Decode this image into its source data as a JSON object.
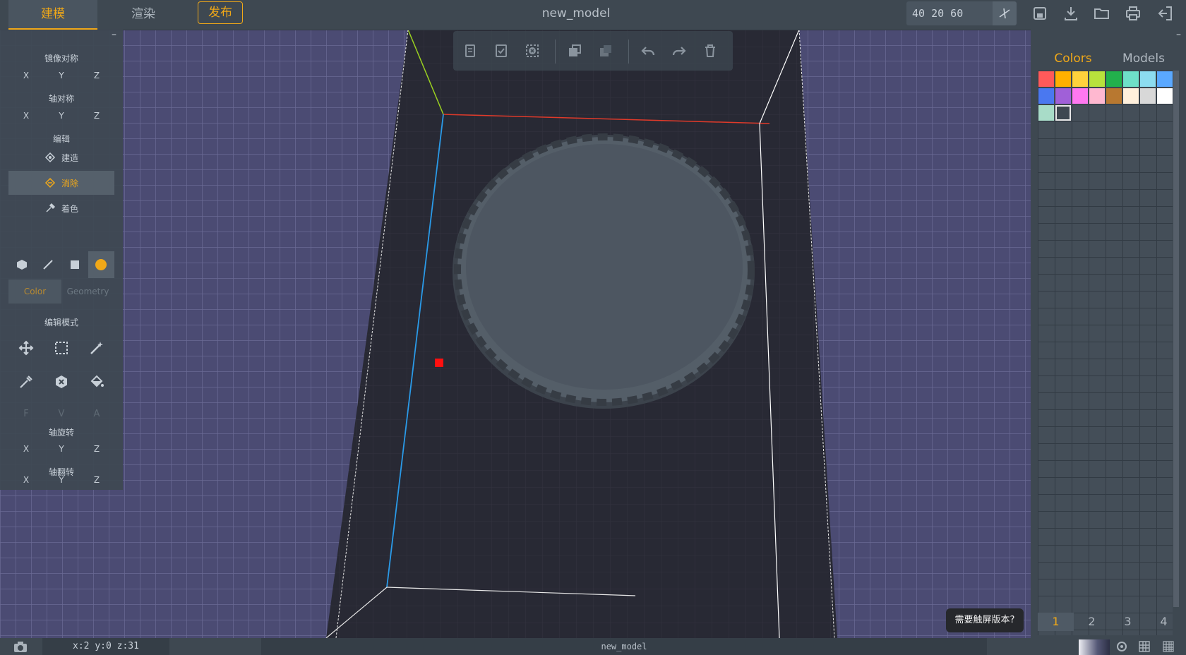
{
  "topbar": {
    "tab_model": "建模",
    "tab_render": "渲染",
    "publish": "发布",
    "title": "new_model",
    "dims": "40 20 60"
  },
  "left": {
    "mirror_title": "镜像对称",
    "axis_sym_title": "轴对称",
    "edit_title": "编辑",
    "build": "建造",
    "erase": "消除",
    "paint": "着色",
    "color_tab": "Color",
    "geometry_tab": "Geometry",
    "edit_mode_title": "编辑模式",
    "rotate_title": "轴旋转",
    "flip_title": "轴翻转",
    "x": "X",
    "y": "Y",
    "z": "Z",
    "f": "F",
    "v": "V",
    "a": "A"
  },
  "right": {
    "colors_tab": "Colors",
    "models_tab": "Models",
    "pages": [
      "1",
      "2",
      "3",
      "4"
    ],
    "palette": [
      "#ff5a5a",
      "#ffb000",
      "#ffd23c",
      "#b8e23c",
      "#22b04c",
      "#6ee0c8",
      "#8cdcf0",
      "#5aa8ff",
      "#4a78f0",
      "#a060d8",
      "#ff78f0",
      "#ffb8d0",
      "#b87830",
      "#fff0dc",
      "#d8d8d8",
      "#ffffff",
      "#a8dcc8",
      "#3e4851"
    ]
  },
  "popup": {
    "touch": "需要触屏版本?"
  },
  "status": {
    "coords": "x:2  y:0  z:31",
    "name": "new_model"
  },
  "colors": {
    "accent": "#f0a818",
    "bg": "#3e4851"
  }
}
